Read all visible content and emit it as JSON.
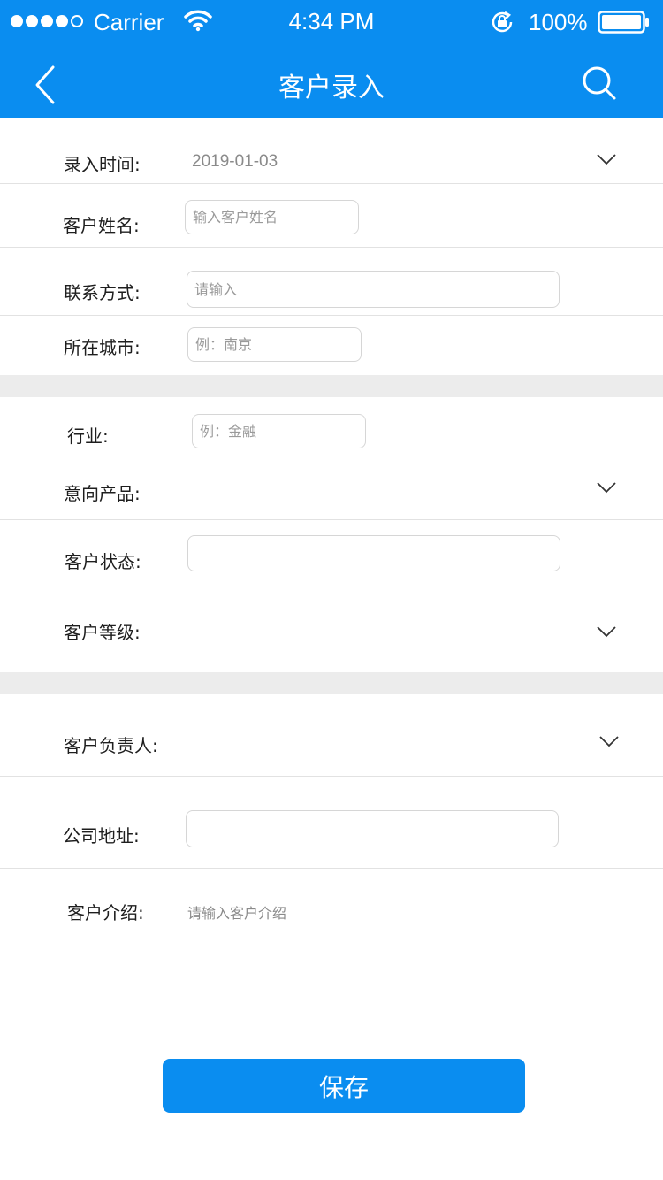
{
  "status_bar": {
    "carrier": "Carrier",
    "time": "4:34 PM",
    "battery": "100%",
    "signal_icon": "signal-dots-icon",
    "wifi_icon": "wifi-icon",
    "lock_icon": "rotation-lock-icon",
    "battery_icon": "battery-icon"
  },
  "nav": {
    "title": "客户录入",
    "back_icon": "chevron-left-icon",
    "search_icon": "search-icon"
  },
  "form": {
    "entry_time": {
      "label": "录入时间:",
      "value": "2019-01-03"
    },
    "customer_name": {
      "label": "客户姓名:",
      "placeholder": "输入客户姓名"
    },
    "contact": {
      "label": "联系方式:",
      "placeholder": "请输入"
    },
    "city": {
      "label": "所在城市:",
      "placeholder": "例：南京"
    },
    "industry": {
      "label": "行业:",
      "placeholder": "例：金融"
    },
    "intended_product": {
      "label": "意向产品:"
    },
    "customer_status": {
      "label": "客户状态:",
      "placeholder": ""
    },
    "customer_level": {
      "label": "客户等级:"
    },
    "customer_owner": {
      "label": "客户负责人:"
    },
    "company_address": {
      "label": "公司地址:",
      "placeholder": ""
    },
    "customer_intro": {
      "label": "客户介绍:",
      "placeholder": "请输入客户介绍"
    }
  },
  "actions": {
    "save_label": "保存"
  },
  "colors": {
    "accent": "#0a8df0",
    "band": "#ececec",
    "divider": "#e2e2e2"
  }
}
